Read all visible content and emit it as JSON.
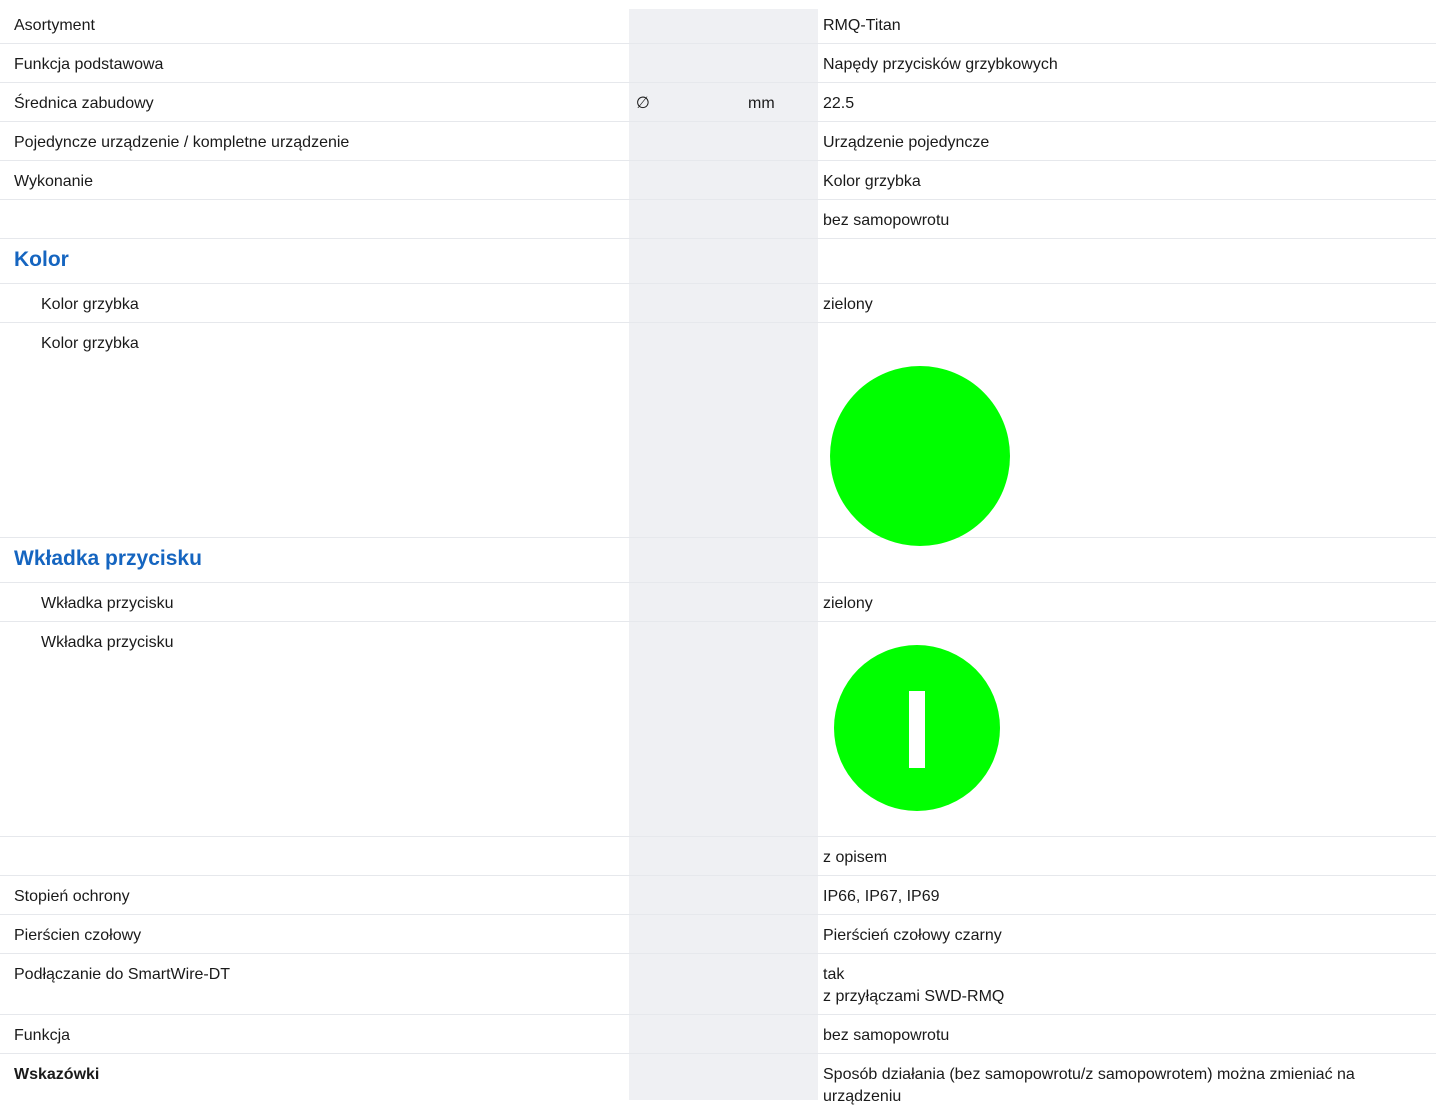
{
  "colors": {
    "section_heading": "#1565c0",
    "mushroom_green": "#00ff00",
    "insert_green": "#00ff00",
    "insert_marking": "#ffffff",
    "shaded_column": "#eff0f3"
  },
  "rows": {
    "asortyment": {
      "label": "Asortyment",
      "value": "RMQ-Titan"
    },
    "funkcja_podstawowa": {
      "label": "Funkcja podstawowa",
      "value": "Napędy przycisków grzybkowych"
    },
    "srednica": {
      "label": "Średnica zabudowy",
      "symbol": "∅",
      "unit": "mm",
      "value": "22.5"
    },
    "pojedyncze": {
      "label": "Pojedyncze urządzenie / kompletne urządzenie",
      "value": "Urządzenie pojedyncze"
    },
    "wykonanie": {
      "label": "Wykonanie",
      "value": "Kolor grzybka",
      "value_2": "bez samopowrotu"
    },
    "kolor_section": {
      "label": "Kolor"
    },
    "kolor_grzybka": {
      "label": "Kolor grzybka",
      "value": "zielony"
    },
    "kolor_grzybka_img": {
      "label": "Kolor grzybka",
      "icon": "green-circle-swatch"
    },
    "wkladka_section": {
      "label": "Wkładka przycisku"
    },
    "wkladka": {
      "label": "Wkładka przycisku",
      "value": "zielony"
    },
    "wkladka_img": {
      "label": "Wkładka przycisku",
      "icon": "green-on-button-icon"
    },
    "opis": {
      "value": "z opisem"
    },
    "stopien_ochrony": {
      "label": "Stopień ochrony",
      "value": "IP66, IP67, IP69"
    },
    "pierscien": {
      "label": "Pierścien czołowy",
      "value": "Pierścień czołowy czarny"
    },
    "smartwire": {
      "label": "Podłączanie do SmartWire-DT",
      "value_line1": "tak",
      "value_line2": "z przyłączami SWD-RMQ"
    },
    "funkcja": {
      "label": "Funkcja",
      "value": "bez samopowrotu"
    },
    "wskazowki": {
      "label": "Wskazówki",
      "value": "Sposób działania (bez samopowrotu/z samopowrotem) można zmieniać na urządzeniu"
    }
  }
}
